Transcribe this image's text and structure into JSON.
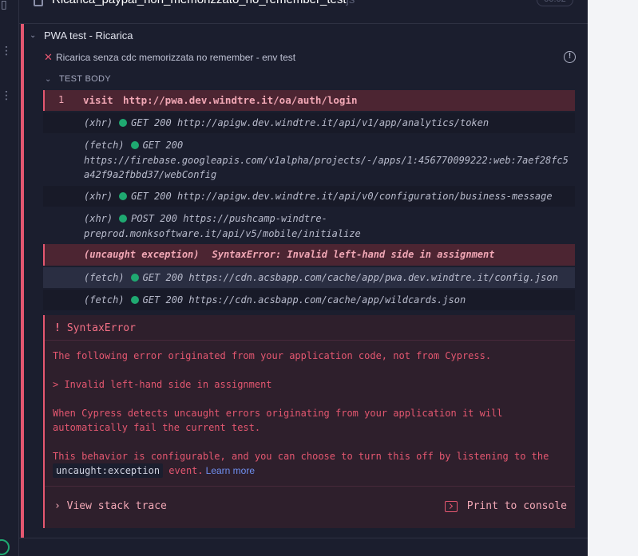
{
  "previous_test": {
    "title": "Ricarica_paypal_non_memorizzato_no_remember_test",
    "ext": "js",
    "duration": "00:02"
  },
  "suite": {
    "title": "PWA test - Ricarica"
  },
  "test": {
    "title": "Ricarica senza cdc memorizzata no remember - env test",
    "status": "failed"
  },
  "test_body": {
    "label": "TEST BODY"
  },
  "commands": {
    "visit": {
      "number": "1",
      "name": "visit",
      "message": "http://pwa.dev.windtre.it/oa/auth/login"
    },
    "logs": [
      {
        "type": "(xhr)",
        "method": "GET",
        "status": "200",
        "lines": [
          "http://apigw.dev.windtre.it/api/v1/app/analytics/token"
        ]
      },
      {
        "type": "(fetch)",
        "method": "GET",
        "status": "200",
        "lines": [
          "https://firebase.googleapis.com/v1alpha/projects/-/apps/1:456770099222:web:7aef28fc5",
          "a42f9a2fbbd37/webConfig"
        ]
      },
      {
        "type": "(xhr)",
        "method": "GET",
        "status": "200",
        "lines": [
          "http://apigw.dev.windtre.it/api/v0/configuration/business-message"
        ]
      },
      {
        "type": "(xhr)",
        "method": "POST",
        "status": "200",
        "lines": [
          "https://pushcamp-windtre-",
          "preprod.monksoftware.it/api/v5/mobile/initialize"
        ]
      },
      {
        "type": "(fetch)",
        "method": "GET",
        "status": "200",
        "lines": [
          "https://cdn.acsbapp.com/cache/app/pwa.dev.windtre.it/config.json"
        ]
      },
      {
        "type": "(fetch)",
        "method": "GET",
        "status": "200",
        "lines": [
          "https://cdn.acsbapp.com/cache/app/wildcards.json"
        ]
      }
    ],
    "exception": {
      "type": "(uncaught exception)",
      "message": "SyntaxError: Invalid left-hand side in assignment"
    }
  },
  "error": {
    "title": "SyntaxError",
    "line1": "The following error originated from your application code, not from Cypress.",
    "line2": "> Invalid left-hand side in assignment",
    "line3a": "When Cypress detects uncaught errors originating from your application it will",
    "line3b": "automatically fail the current test.",
    "line4a": "This behavior is configurable, and you can choose to turn this off by listening to the",
    "code": "uncaught:exception",
    "event_word": "event.",
    "learn_more": "Learn more",
    "view_stack": "View stack trace",
    "print_console": "Print to console"
  },
  "colors": {
    "fail": "#e45770",
    "pass": "#1fa971",
    "bg": "#1b1e2e",
    "link": "#6f8ff0"
  }
}
